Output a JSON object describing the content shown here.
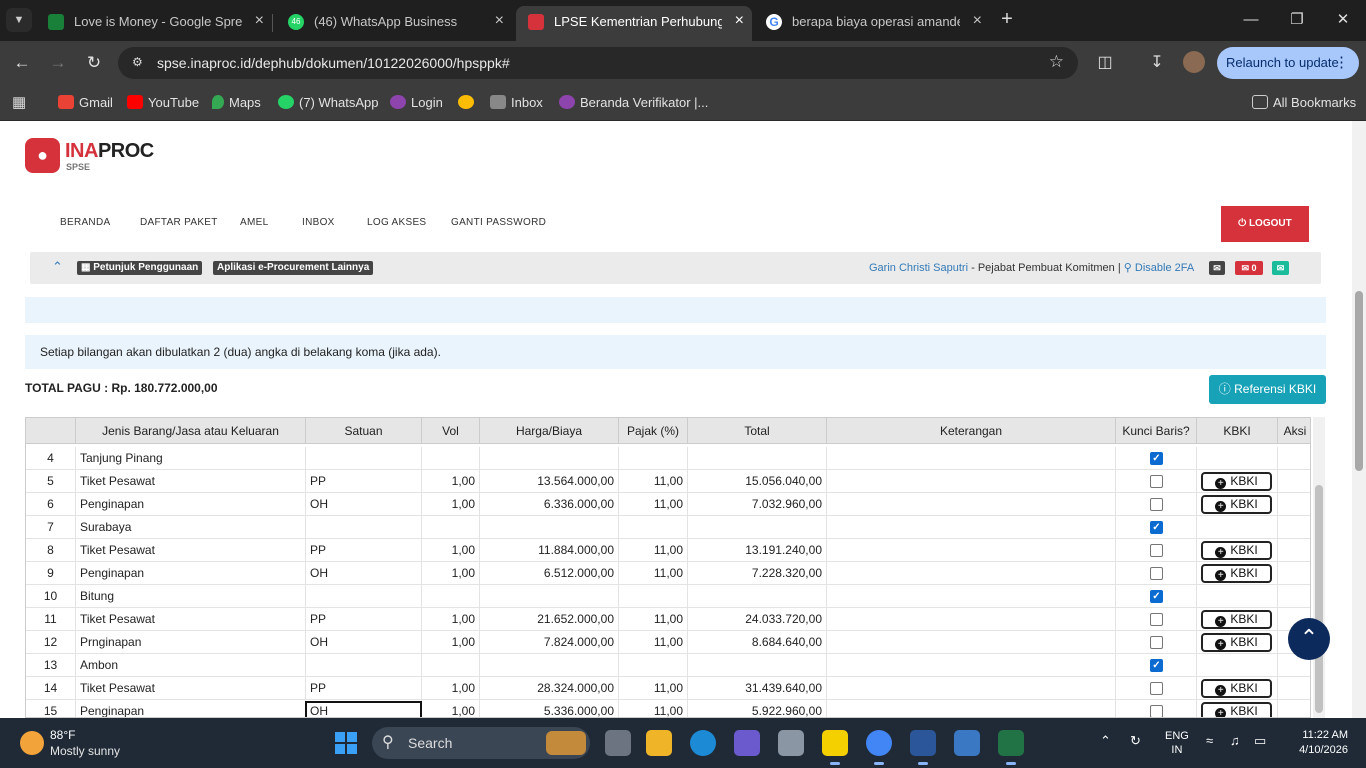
{
  "browser": {
    "tabs": [
      {
        "title": "Love is Money - Google Spread",
        "favicon_color": "#188038",
        "active": false
      },
      {
        "title": "(46) WhatsApp Business",
        "favicon_color": "#25d366",
        "active": false
      },
      {
        "title": "LPSE Kementrian Perhubungan",
        "favicon_color": "#d5323c",
        "active": true
      },
      {
        "title": "berapa biaya operasi amandel",
        "favicon_color": "#ffffff",
        "active": false
      }
    ],
    "url": "spse.inaproc.id/dephub/dokumen/10122026000/hpsppk#",
    "relaunch_label": "Relaunch to update",
    "bookmarks": [
      {
        "label": "Gmail",
        "color": "#ea4335"
      },
      {
        "label": "YouTube",
        "color": "#ff0000"
      },
      {
        "label": "Maps",
        "color": "#34a853"
      },
      {
        "label": "(7) WhatsApp",
        "color": "#25d366"
      },
      {
        "label": "Login",
        "color": "#8e44ad"
      },
      {
        "label": "",
        "color": "#fbbc04"
      },
      {
        "label": "Inbox",
        "color": "#888888"
      },
      {
        "label": "Beranda Verifikator |...",
        "color": "#8e44ad"
      }
    ],
    "all_bookmarks": "All Bookmarks"
  },
  "site": {
    "logo_name_red": "INA",
    "logo_name_dark": "PROC",
    "logo_sub": "SPSE",
    "nav": [
      "BERANDA",
      "DAFTAR PAKET",
      "AMEL",
      "INBOX",
      "LOG AKSES",
      "GANTI PASSWORD"
    ],
    "logout": "LOGOUT",
    "guide_label": "Petunjuk Penggunaan",
    "apps_label": "Aplikasi e-Procurement Lainnya",
    "user_name": "Garin Christi Saputri",
    "user_role": " - Pejabat Pembuat Komitmen | ",
    "disable_2fa": "Disable 2FA",
    "msg_count": "0"
  },
  "notice": "Setiap bilangan akan dibulatkan 2 (dua) angka di belakang koma (jika ada).",
  "total_pagu": "TOTAL PAGU : Rp. 180.772.000,00",
  "ref_kbki_label": "Referensi KBKI",
  "table": {
    "columns": [
      "",
      "Jenis Barang/Jasa atau Keluaran",
      "Satuan",
      "Vol",
      "Harga/Biaya",
      "Pajak (%)",
      "Total",
      "Keterangan",
      "Kunci Baris?",
      "KBKI",
      "Aksi"
    ],
    "kbki_button": "KBKI",
    "rows": [
      {
        "no": "4",
        "jenis": "Tanjung Pinang",
        "satuan": "",
        "vol": "",
        "harga": "",
        "pajak": "",
        "total": "",
        "kunci": true,
        "kbki": false
      },
      {
        "no": "5",
        "jenis": "Tiket Pesawat",
        "satuan": "PP",
        "vol": "1,00",
        "harga": "13.564.000,00",
        "pajak": "11,00",
        "total": "15.056.040,00",
        "kunci": false,
        "kbki": true
      },
      {
        "no": "6",
        "jenis": "Penginapan",
        "satuan": "OH",
        "vol": "1,00",
        "harga": "6.336.000,00",
        "pajak": "11,00",
        "total": "7.032.960,00",
        "kunci": false,
        "kbki": true
      },
      {
        "no": "7",
        "jenis": "Surabaya",
        "satuan": "",
        "vol": "",
        "harga": "",
        "pajak": "",
        "total": "",
        "kunci": true,
        "kbki": false
      },
      {
        "no": "8",
        "jenis": "Tiket Pesawat",
        "satuan": "PP",
        "vol": "1,00",
        "harga": "11.884.000,00",
        "pajak": "11,00",
        "total": "13.191.240,00",
        "kunci": false,
        "kbki": true
      },
      {
        "no": "9",
        "jenis": "Penginapan",
        "satuan": "OH",
        "vol": "1,00",
        "harga": "6.512.000,00",
        "pajak": "11,00",
        "total": "7.228.320,00",
        "kunci": false,
        "kbki": true
      },
      {
        "no": "10",
        "jenis": "Bitung",
        "satuan": "",
        "vol": "",
        "harga": "",
        "pajak": "",
        "total": "",
        "kunci": true,
        "kbki": false
      },
      {
        "no": "11",
        "jenis": "Tiket Pesawat",
        "satuan": "PP",
        "vol": "1,00",
        "harga": "21.652.000,00",
        "pajak": "11,00",
        "total": "24.033.720,00",
        "kunci": false,
        "kbki": true
      },
      {
        "no": "12",
        "jenis": "Prnginapan",
        "satuan": "OH",
        "vol": "1,00",
        "harga": "7.824.000,00",
        "pajak": "11,00",
        "total": "8.684.640,00",
        "kunci": false,
        "kbki": true
      },
      {
        "no": "13",
        "jenis": "Ambon",
        "satuan": "",
        "vol": "",
        "harga": "",
        "pajak": "",
        "total": "",
        "kunci": true,
        "kbki": false
      },
      {
        "no": "14",
        "jenis": "Tiket Pesawat",
        "satuan": "PP",
        "vol": "1,00",
        "harga": "28.324.000,00",
        "pajak": "11,00",
        "total": "31.439.640,00",
        "kunci": false,
        "kbki": true
      },
      {
        "no": "15",
        "jenis": "Penginapan",
        "satuan": "OH",
        "vol": "1,00",
        "harga": "5.336.000,00",
        "pajak": "11,00",
        "total": "5.922.960,00",
        "kunci": false,
        "kbki": true
      }
    ]
  },
  "taskbar": {
    "temp": "88°F",
    "weather": "Mostly sunny",
    "search_placeholder": "Search",
    "lang_top": "ENG",
    "lang_bottom": "IN",
    "time": "11:22 AM",
    "date": "4/10/2026"
  }
}
